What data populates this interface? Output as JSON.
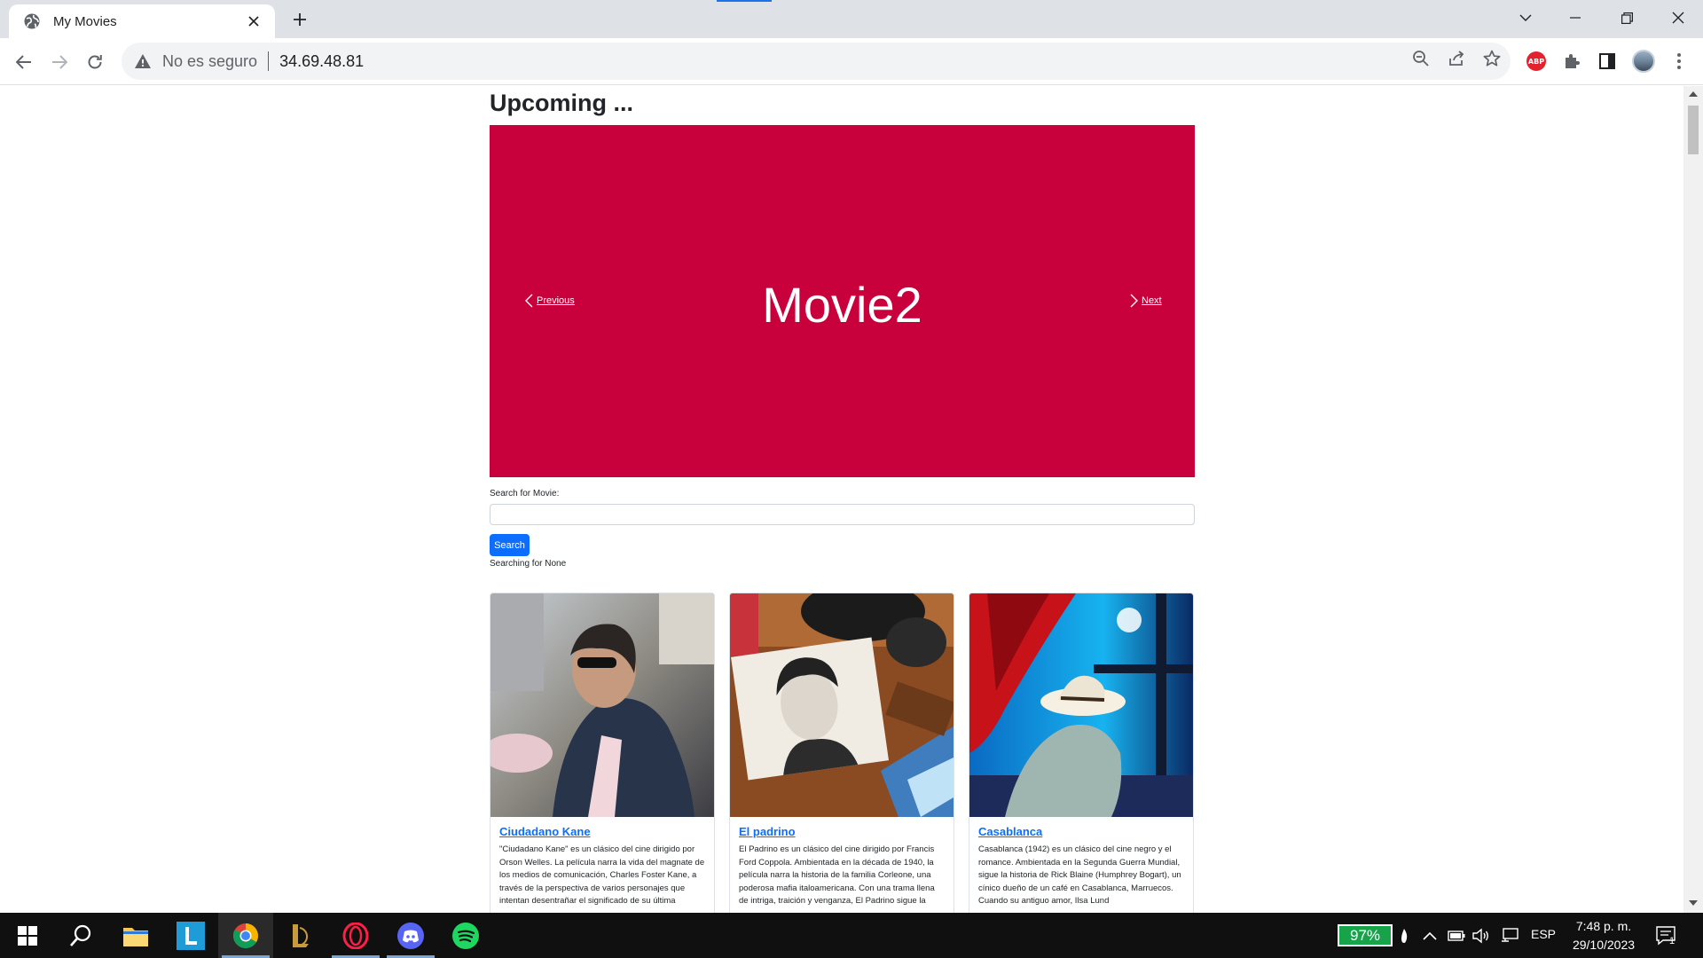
{
  "browser": {
    "tab_title": "My Movies",
    "security_label": "No es seguro",
    "url": "34.69.48.81",
    "extension_abp": "ABP"
  },
  "page": {
    "heading": "Upcoming ...",
    "carousel": {
      "slide_title": "Movie2",
      "prev_label": "Previous",
      "next_label": "Next",
      "background": "#c8003c"
    },
    "search": {
      "label": "Search for Movie:",
      "placeholder": "",
      "value": "",
      "button_label": "Search",
      "status": "Searching for None"
    },
    "movies": [
      {
        "title": "Ciudadano Kane",
        "description": "\"Ciudadano Kane\" es un clásico del cine dirigido por Orson Welles. La película narra la vida del magnate de los medios de comunicación, Charles Foster Kane, a través de la perspectiva de varios personajes que intentan desentrañar el significado de su última"
      },
      {
        "title": "El padrino",
        "description": "El Padrino es un clásico del cine dirigido por Francis Ford Coppola. Ambientada en la década de 1940, la película narra la historia de la familia Corleone, una poderosa mafia italoamericana. Con una trama llena de intriga, traición y venganza, El Padrino sigue la"
      },
      {
        "title": "Casablanca",
        "description": "Casablanca (1942) es un clásico del cine negro y el romance. Ambientada en la Segunda Guerra Mundial, sigue la historia de Rick Blaine (Humphrey Bogart), un cínico dueño de un café en Casablanca, Marruecos. Cuando su antiguo amor, Ilsa Lund"
      }
    ]
  },
  "taskbar": {
    "battery": "97%",
    "language": "ESP",
    "time": "7:48 p. m.",
    "date": "29/10/2023",
    "notification_count": "1"
  }
}
